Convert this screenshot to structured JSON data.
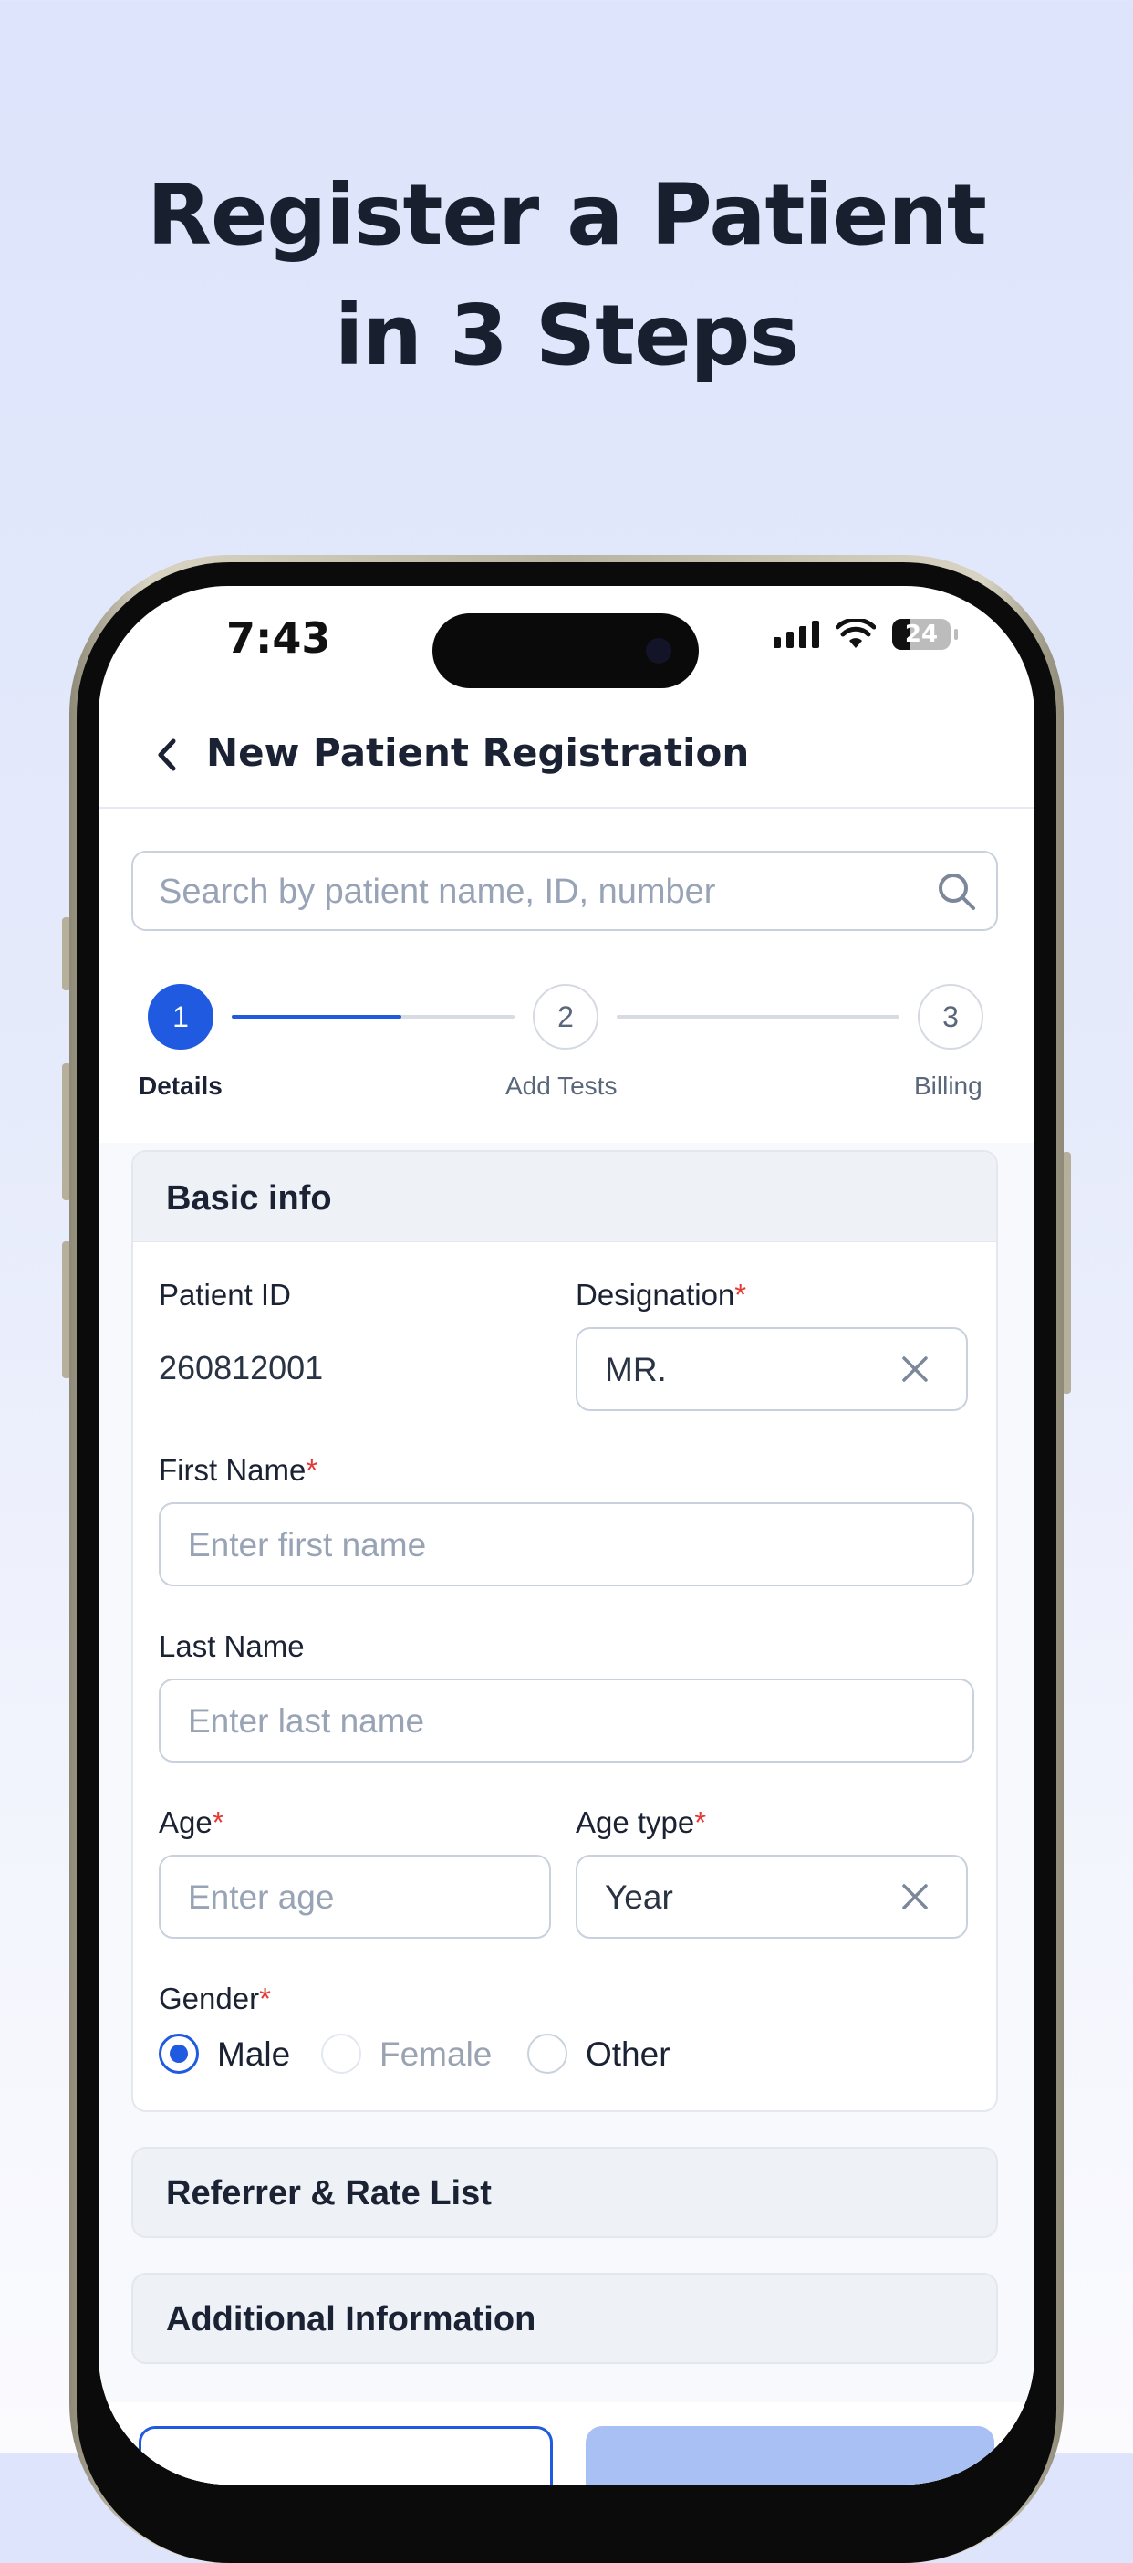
{
  "hero": {
    "line1": "Register a Patient",
    "line2": "in 3 Steps"
  },
  "status_bar": {
    "time": "7:43",
    "battery": "24"
  },
  "header": {
    "title": "New Patient Registration"
  },
  "search": {
    "placeholder": "Search by patient name, ID, number"
  },
  "stepper": {
    "progress": 0.6,
    "steps": [
      {
        "number": "1",
        "label": "Details",
        "state": "active"
      },
      {
        "number": "2",
        "label": "Add Tests",
        "state": "pending"
      },
      {
        "number": "3",
        "label": "Billing",
        "state": "pending"
      }
    ]
  },
  "basic_info": {
    "title": "Basic info",
    "patient_id_label": "Patient ID",
    "patient_id_value": "260812001",
    "designation_label": "Designation",
    "designation_value": "MR.",
    "first_name_label": "First Name",
    "first_name_placeholder": "Enter first name",
    "last_name_label": "Last Name",
    "last_name_placeholder": "Enter last name",
    "age_label": "Age",
    "age_placeholder": "Enter age",
    "age_type_label": "Age type",
    "age_type_value": "Year",
    "required_mark": "*",
    "gender_label": "Gender",
    "gender_options": [
      "Male",
      "Female",
      "Other"
    ],
    "gender_selected": "Male"
  },
  "sections": {
    "referrer": "Referrer & Rate List",
    "additional": "Additional Information"
  },
  "colors": {
    "accent": "#1f5ae0",
    "required": "#e53935",
    "background": "#dde4fb"
  }
}
